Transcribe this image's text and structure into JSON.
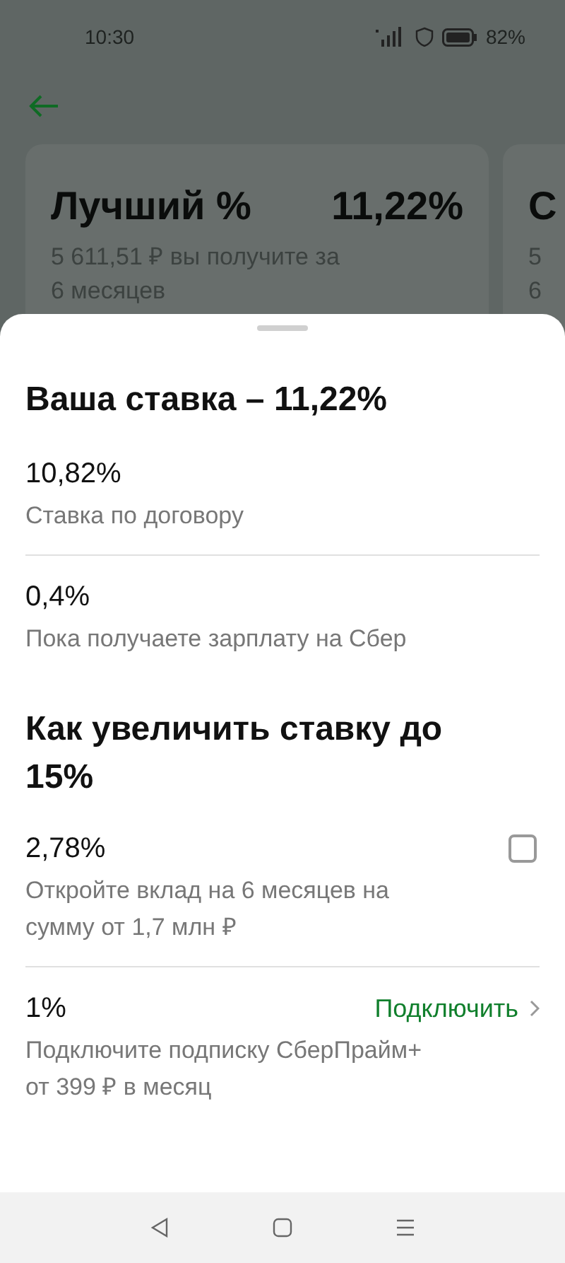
{
  "status_bar": {
    "time": "10:30",
    "battery": "82%"
  },
  "cards": [
    {
      "title": "Лучший %",
      "rate": "11,22%",
      "description": "5 611,51 ₽ вы получите за",
      "description_2": "6 месяцев"
    },
    {
      "title": "С",
      "description": "5",
      "description_2": "6"
    }
  ],
  "sheet": {
    "title": "Ваша ставка – 11,22%",
    "rates": [
      {
        "value": "10,82%",
        "label": "Ставка по договору"
      },
      {
        "value": "0,4%",
        "label": "Пока получаете зарплату на Сбер"
      }
    ],
    "boost_title": "Как увеличить ставку до 15%",
    "options": [
      {
        "kind": "checkbox",
        "value": "2,78%",
        "label": "Откройте вклад на 6 месяцев на сумму от 1,7 млн ₽",
        "checked": false
      },
      {
        "kind": "link",
        "value": "1%",
        "label": "Подключите подписку СберПрайм+ от 399 ₽ в месяц",
        "action": "Подключить"
      }
    ]
  }
}
